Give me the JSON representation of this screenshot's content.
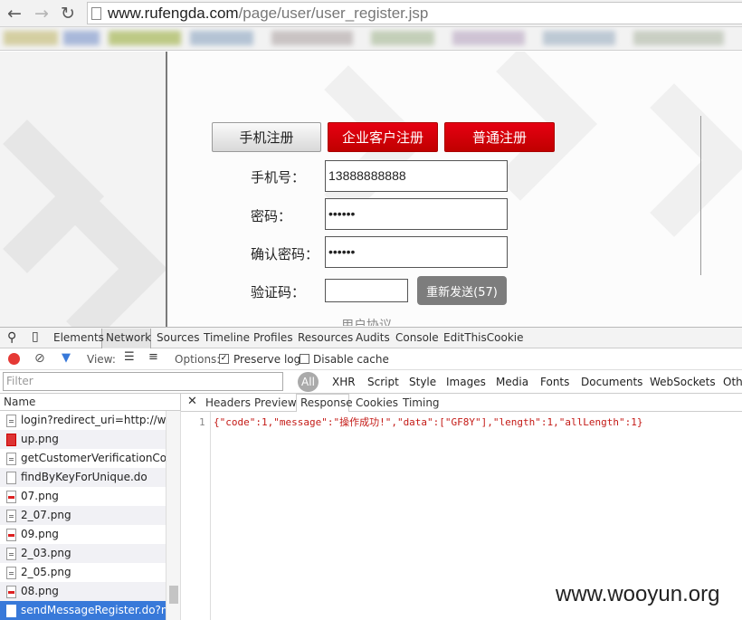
{
  "browser": {
    "url_host": "www.rufengda.com",
    "url_path": "/page/user/user_register.jsp"
  },
  "form": {
    "tabs": [
      "手机注册",
      "企业客户注册",
      "普通注册"
    ],
    "phone_label": "手机号：",
    "phone_value": "13888888888",
    "password_label": "密码：",
    "password_value": "••••••",
    "confirm_label": "确认密码：",
    "confirm_value": "••••••",
    "code_label": "验证码：",
    "code_value": "",
    "resend_label": "重新发送(57)",
    "cutoff_text": "用户协议"
  },
  "devtools": {
    "tabs": [
      "Elements",
      "Network",
      "Sources",
      "Timeline",
      "Profiles",
      "Resources",
      "Audits",
      "Console",
      "EditThisCookie"
    ],
    "view_label": "View:",
    "options_label": "Options:",
    "preserve_log": "Preserve log",
    "disable_cache": "Disable cache",
    "filter_placeholder": "Filter",
    "filter_types": [
      "All",
      "XHR",
      "Script",
      "Style",
      "Images",
      "Media",
      "Fonts",
      "Documents",
      "WebSockets",
      "Other"
    ],
    "name_header": "Name",
    "requests": [
      {
        "name": "login?redirect_uri=http://w...",
        "icon": "doc"
      },
      {
        "name": "up.png",
        "icon": "err"
      },
      {
        "name": "getCustomerVerificationCo...",
        "icon": "doc"
      },
      {
        "name": "findByKeyForUnique.do",
        "icon": "blank"
      },
      {
        "name": "07.png",
        "icon": "img"
      },
      {
        "name": "2_07.png",
        "icon": "doc"
      },
      {
        "name": "09.png",
        "icon": "img"
      },
      {
        "name": "2_03.png",
        "icon": "doc"
      },
      {
        "name": "2_05.png",
        "icon": "doc"
      },
      {
        "name": "08.png",
        "icon": "img"
      },
      {
        "name": "sendMessageRegister.do?m...",
        "icon": "blank"
      }
    ],
    "response_tabs": [
      "Headers",
      "Preview",
      "Response",
      "Cookies",
      "Timing"
    ],
    "line_number": "1",
    "response_body": "{\"code\":1,\"message\":\"操作成功!\",\"data\":[\"GF8Y\"],\"length\":1,\"allLength\":1}"
  },
  "watermark": "www.wooyun.org"
}
